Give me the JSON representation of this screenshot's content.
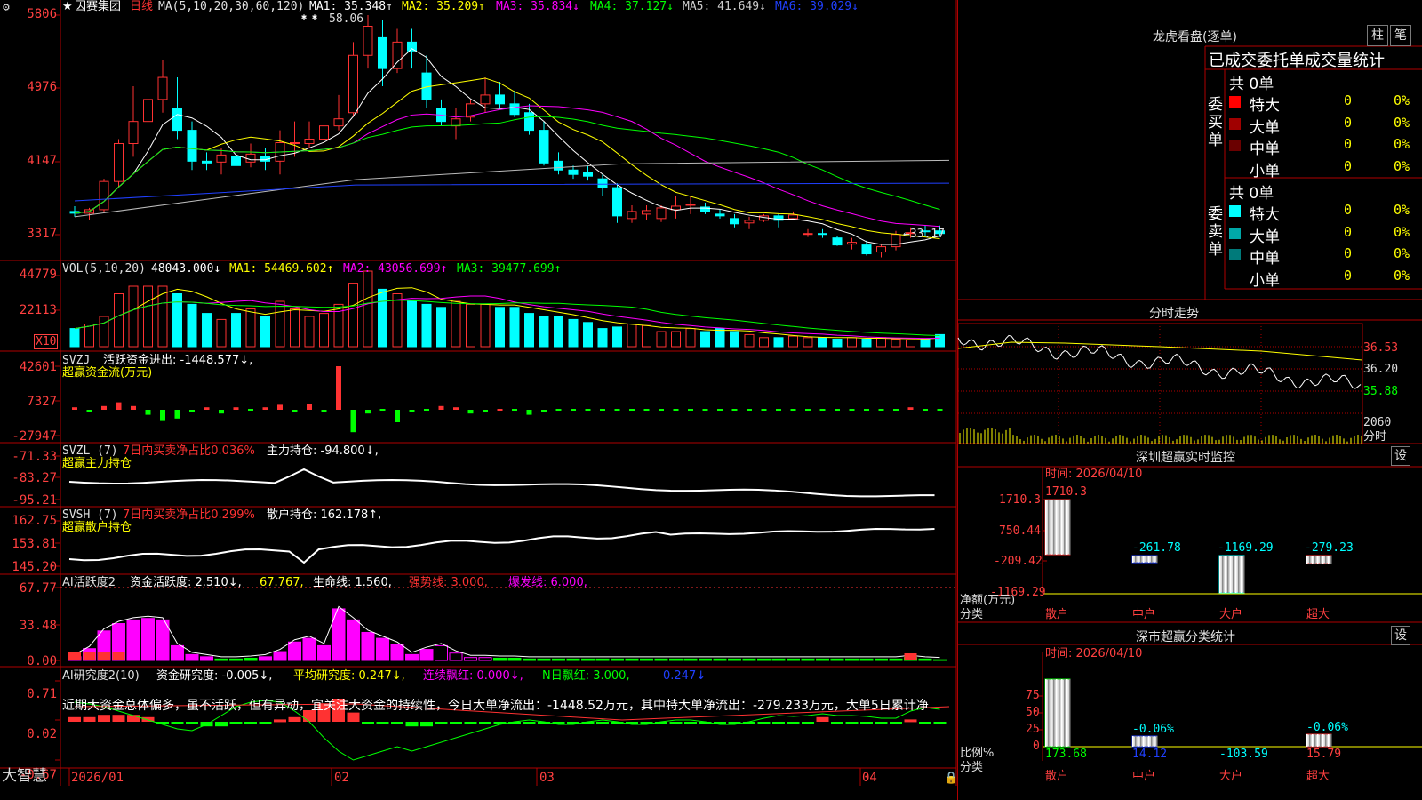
{
  "app": {
    "name": "大智慧"
  },
  "main": {
    "title_star": "★",
    "stock_name": "因赛集团",
    "period": "日线",
    "ma_title": "MA(5,10,20,30,60,120)",
    "ma1": "MA1: 35.348↑",
    "ma2": "MA2: 35.209↑",
    "ma3": "MA3: 35.834↓",
    "ma4": "MA4: 37.127↓",
    "ma5": "MA5: 41.649↓",
    "ma6": "MA6: 39.029↓",
    "y_labels": [
      "5806",
      "4976",
      "4147",
      "3317"
    ],
    "high_label": "58.06",
    "low_label": "←33.17"
  },
  "vol": {
    "title": "VOL(5,10,20)",
    "value": "48043.000↓",
    "ma1": "MA1: 54469.602↑",
    "ma2": "MA2: 43056.699↑",
    "ma3": "MA3: 39477.699↑",
    "y_labels": [
      "44779",
      "22113"
    ],
    "unit": "X10"
  },
  "svzj": {
    "title": "SVZJ",
    "label": "活跃资金进出: -1448.577↓,",
    "subtitle": "超赢资金流(万元)",
    "y_labels": [
      "42601",
      "7327",
      "-27947"
    ]
  },
  "svzl": {
    "title": "SVZL (7)",
    "ratio": "7日内买卖净占比0.036%",
    "label": "主力持仓: -94.800↓,",
    "subtitle": "超赢主力持仓",
    "y_labels": [
      "-71.33",
      "-83.27",
      "-95.21"
    ]
  },
  "svsh": {
    "title": "SVSH (7)",
    "ratio": "7日内买卖净占比0.299%",
    "label": "散户持仓: 162.178↑,",
    "subtitle": "超赢散户持仓",
    "y_labels": [
      "162.75",
      "153.81",
      "145.20"
    ]
  },
  "ai_act": {
    "title": "AI活跃度2",
    "a": "资金活跃度: 2.510↓,",
    "b": "67.767,",
    "c": "生命线: 1.560,",
    "d": "强势线: 3.000,",
    "e": "爆发线: 6.000,",
    "y_labels": [
      "67.77",
      "33.48",
      "0.00"
    ]
  },
  "ai_res": {
    "title": "AI研究度2(10)",
    "a": "资金研究度: -0.005↓,",
    "b": "平均研究度: 0.247↓,",
    "c": "连续飘红: 0.000↓,",
    "d": "N日飘红: 3.000,",
    "e": "0.247↓",
    "text": "近期大资金总体偏多，虽不活跃，但有异动，宜关注大资金的持续性，今日大单净流出：-1448.52万元，其中特大单净流出：-279.233万元，大单5日累计净",
    "y_labels": [
      "0.71",
      "0.02",
      "-0.67"
    ]
  },
  "x_axis": {
    "labels": [
      "2026/01",
      "02",
      "03",
      "04"
    ]
  },
  "lhb": {
    "title": "龙虎看盘(逐单)",
    "btn1": "柱",
    "btn2": "笔",
    "header": "已成交委托单成交量统计",
    "buy": {
      "side": "委买单",
      "total": "共 0单",
      "rows": [
        {
          "name": "特大",
          "count": "0",
          "pct": "0%",
          "color": "#ff0000"
        },
        {
          "name": "大单",
          "count": "0",
          "pct": "0%",
          "color": "#a00000"
        },
        {
          "name": "中单",
          "count": "0",
          "pct": "0%",
          "color": "#6a0000"
        },
        {
          "name": "小单",
          "count": "0",
          "pct": "0%",
          "color": "#000000"
        }
      ]
    },
    "sell": {
      "side": "委卖单",
      "total": "共 0单",
      "rows": [
        {
          "name": "特大",
          "count": "0",
          "pct": "0%",
          "color": "#00ffff"
        },
        {
          "name": "大单",
          "count": "0",
          "pct": "0%",
          "color": "#00a8a8"
        },
        {
          "name": "中单",
          "count": "0",
          "pct": "0%",
          "color": "#007a7a"
        },
        {
          "name": "小单",
          "count": "0",
          "pct": "0%",
          "color": "#000000"
        }
      ]
    }
  },
  "fenshi": {
    "title": "分时走势",
    "y_labels": [
      "36.53",
      "36.20",
      "35.88"
    ],
    "vol_label": "2060",
    "unit": "分时"
  },
  "sz_monitor": {
    "title": "深圳超赢实时监控",
    "btn": "设",
    "time": "时间: 2026/04/10",
    "y_labels": [
      "1710.3",
      "750.44",
      "-209.42",
      "-1169.29"
    ],
    "top_value": "1710.3",
    "bars": [
      {
        "cat": "散户",
        "value": "1710.3"
      },
      {
        "cat": "中户",
        "value": "-261.78"
      },
      {
        "cat": "大户",
        "value": "-1169.29"
      },
      {
        "cat": "超大",
        "value": "-279.23"
      }
    ],
    "ylabel": "净额(万元)",
    "xlabel": "分类"
  },
  "sz_class": {
    "title": "深市超赢分类统计",
    "btn": "设",
    "time": "时间: 2026/04/10",
    "y_labels": [
      "75",
      "50",
      "25",
      "0"
    ],
    "pct_labels": [
      "-0.06%",
      "-0.06%"
    ],
    "bars": [
      {
        "cat": "散户",
        "value": "173.68"
      },
      {
        "cat": "中户",
        "value": "14.12"
      },
      {
        "cat": "大户",
        "value": "-103.59"
      },
      {
        "cat": "超大",
        "value": "15.79"
      }
    ],
    "ylabel": "比例%",
    "xlabel": "分类"
  },
  "colors": {
    "up": "#ff3232",
    "down": "#00ffff",
    "grid": "#b00000",
    "yellow": "#ffff00",
    "magenta": "#ff00ff",
    "green": "#00ff00",
    "blue": "#2040ff",
    "white": "#ffffff"
  },
  "chart_data": [
    {
      "type": "line",
      "title": "因赛集团 日线",
      "ylim": [
        31.5,
        60
      ],
      "high": 58.06,
      "low": 33.17,
      "x": [
        1,
        2,
        3,
        4,
        5,
        6,
        7,
        8,
        9,
        10,
        11,
        12,
        13,
        14,
        15,
        16,
        17,
        18,
        19,
        20,
        21,
        22,
        23,
        24,
        25,
        26,
        27,
        28,
        29,
        30,
        31,
        32,
        33,
        34,
        35,
        36,
        37,
        38,
        39,
        40,
        41,
        42,
        43,
        44,
        45,
        46,
        47,
        48,
        49,
        50,
        51,
        52,
        53,
        54,
        55,
        56,
        57,
        58,
        59,
        60
      ],
      "ohlc": [
        [
          35.8,
          36.4,
          35.2,
          35.6
        ],
        [
          35.6,
          36.2,
          34.8,
          36.0
        ],
        [
          36.0,
          39.5,
          35.7,
          39.2
        ],
        [
          39.2,
          44.0,
          38.5,
          43.5
        ],
        [
          43.5,
          50.0,
          42.0,
          46.0
        ],
        [
          46.0,
          50.5,
          44.0,
          48.5
        ],
        [
          48.5,
          53.0,
          47.0,
          51.0
        ],
        [
          47.5,
          51.0,
          44.0,
          45.0
        ],
        [
          45.0,
          46.0,
          40.5,
          41.5
        ],
        [
          41.5,
          42.5,
          40.5,
          41.3
        ],
        [
          41.4,
          43.0,
          40.0,
          42.2
        ],
        [
          42.0,
          42.7,
          40.4,
          41.0
        ],
        [
          41.4,
          43.5,
          40.8,
          42.3
        ],
        [
          42.0,
          43.0,
          40.5,
          41.5
        ],
        [
          41.5,
          45.0,
          40.0,
          43.6
        ],
        [
          43.5,
          46.0,
          42.0,
          43.6
        ],
        [
          43.5,
          46.0,
          43.0,
          44.0
        ],
        [
          44.0,
          47.5,
          42.5,
          45.5
        ],
        [
          45.5,
          49.0,
          45.0,
          46.3
        ],
        [
          47.0,
          55.0,
          46.5,
          53.5
        ],
        [
          53.5,
          58.06,
          52.0,
          56.8
        ],
        [
          55.5,
          57.5,
          50.0,
          52.0
        ],
        [
          52.0,
          56.5,
          51.5,
          55.0
        ],
        [
          55.0,
          56.5,
          52.0,
          54.0
        ],
        [
          51.5,
          53.5,
          47.5,
          48.5
        ],
        [
          47.5,
          48.5,
          45.5,
          46.0
        ],
        [
          45.5,
          47.5,
          44.0,
          46.3
        ],
        [
          46.5,
          48.5,
          46.0,
          48.0
        ],
        [
          48.0,
          51.0,
          47.0,
          49.0
        ],
        [
          49.0,
          50.5,
          47.5,
          48.0
        ],
        [
          48.0,
          49.5,
          46.5,
          46.8
        ],
        [
          47.0,
          48.0,
          44.5,
          45.0
        ],
        [
          45.0,
          46.0,
          41.0,
          41.3
        ],
        [
          41.5,
          42.5,
          40.0,
          40.5
        ],
        [
          40.5,
          41.0,
          39.5,
          40.0
        ],
        [
          40.2,
          41.0,
          39.3,
          39.8
        ],
        [
          39.5,
          40.0,
          37.5,
          38.5
        ],
        [
          38.5,
          39.0,
          34.5,
          35.3
        ],
        [
          35.0,
          36.5,
          34.5,
          35.8
        ],
        [
          35.5,
          36.5,
          34.8,
          35.9
        ],
        [
          35.0,
          36.5,
          34.6,
          36.2
        ],
        [
          36.0,
          37.5,
          35.0,
          36.4
        ],
        [
          36.5,
          37.5,
          35.5,
          36.6
        ],
        [
          36.3,
          36.8,
          35.5,
          35.8
        ],
        [
          35.5,
          36.0,
          35.0,
          35.3
        ],
        [
          35.0,
          35.5,
          34.0,
          34.4
        ],
        [
          34.5,
          35.2,
          33.8,
          34.8
        ],
        [
          34.8,
          35.5,
          34.6,
          35.3
        ],
        [
          35.3,
          35.5,
          34.0,
          34.8
        ],
        [
          35.0,
          35.8,
          34.8,
          35.4
        ],
        [
          33.2,
          33.8,
          32.9,
          33.3
        ],
        [
          33.3,
          33.8,
          32.8,
          33.2
        ],
        [
          32.8,
          33.0,
          31.9,
          32.0
        ],
        [
          32.1,
          32.8,
          31.5,
          32.3
        ],
        [
          32.0,
          32.5,
          30.8,
          31.0
        ],
        [
          31.2,
          32.0,
          30.6,
          31.8
        ],
        [
          31.8,
          33.6,
          31.4,
          33.2
        ],
        [
          33.4,
          34.0,
          32.8,
          33.4
        ],
        [
          33.6,
          34.2,
          33.0,
          33.5
        ],
        [
          33.6,
          34.2,
          33.0,
          33.3
        ]
      ]
    },
    {
      "type": "bar",
      "title": "VOL(5,10,20)",
      "ylim": [
        0,
        50000
      ],
      "values": [
        12000,
        15000,
        20000,
        35000,
        40000,
        40000,
        40000,
        35000,
        28000,
        22000,
        18000,
        22000,
        25000,
        20000,
        30000,
        25000,
        20000,
        22000,
        28000,
        42000,
        50000,
        38000,
        35000,
        30000,
        28000,
        26000,
        30000,
        28000,
        28000,
        26000,
        26000,
        22000,
        20000,
        20000,
        18000,
        16000,
        12000,
        13000,
        15000,
        14000,
        10000,
        10000,
        12000,
        10000,
        12000,
        10000,
        8000,
        6000,
        6000,
        7000,
        6000,
        6000,
        5000,
        6000,
        5000,
        6000,
        5000,
        4500,
        5000,
        8000
      ]
    }
  ]
}
